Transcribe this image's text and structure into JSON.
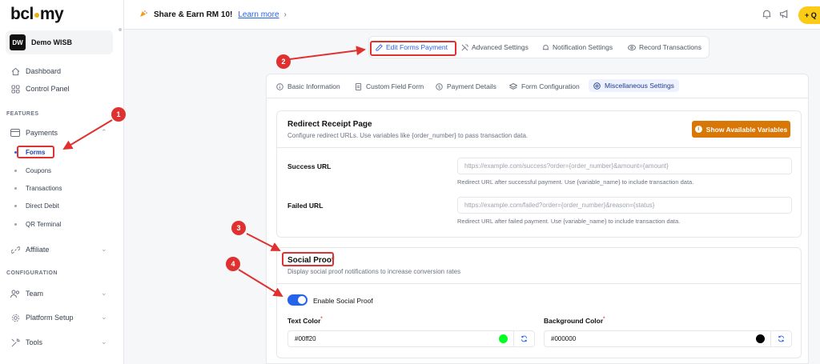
{
  "sidebar": {
    "logo": "bcl",
    "logo_suffix": "my",
    "org_initials": "DW",
    "org_name": "Demo WISB",
    "items": {
      "dashboard": "Dashboard",
      "control_panel": "Control Panel",
      "features_label": "FEATURES",
      "payments": "Payments",
      "forms": "Forms",
      "coupons": "Coupons",
      "transactions": "Transactions",
      "direct_debit": "Direct Debit",
      "qr_terminal": "QR Terminal",
      "affiliate": "Affiliate",
      "configuration_label": "CONFIGURATION",
      "team": "Team",
      "platform_setup": "Platform Setup",
      "tools": "Tools"
    }
  },
  "topbar": {
    "promo_text": "Share & Earn RM 10!",
    "promo_link": "Learn more",
    "action_label": "Q"
  },
  "tabs": {
    "edit": "Edit Forms Payment",
    "advanced": "Advanced Settings",
    "notification": "Notification Settings",
    "record": "Record Transactions"
  },
  "subtabs": {
    "basic": "Basic Information",
    "custom": "Custom Field Form",
    "payment": "Payment Details",
    "config": "Form Configuration",
    "misc": "Miscellaneous Settings"
  },
  "redirect": {
    "title": "Redirect Receipt Page",
    "subtitle": "Configure redirect URLs. Use variables like {order_number} to pass transaction data.",
    "button": "Show Available Variables",
    "success_label": "Success URL",
    "success_placeholder": "https://example.com/success?order={order_number}&amount={amount}",
    "success_help": "Redirect URL after successful payment. Use {variable_name} to include transaction data.",
    "failed_label": "Failed URL",
    "failed_placeholder": "https://example.com/failed?order={order_number}&reason={status}",
    "failed_help": "Redirect URL after failed payment. Use {variable_name} to include transaction data."
  },
  "social": {
    "title": "Social Proof",
    "subtitle": "Display social proof notifications to increase conversion rates",
    "toggle_label": "Enable Social Proof",
    "toggle_on": true,
    "text_color_label": "Text Color",
    "text_color_value": "#00ff20",
    "bg_color_label": "Background Color",
    "bg_color_value": "#000000",
    "required_mark": "*"
  },
  "annotations": [
    "1",
    "2",
    "3",
    "4"
  ],
  "colors": {
    "accent": "#2563eb",
    "annotation": "#e03131",
    "orange": "#d97706",
    "text_swatch": "#00ff20",
    "bg_swatch": "#000000"
  }
}
